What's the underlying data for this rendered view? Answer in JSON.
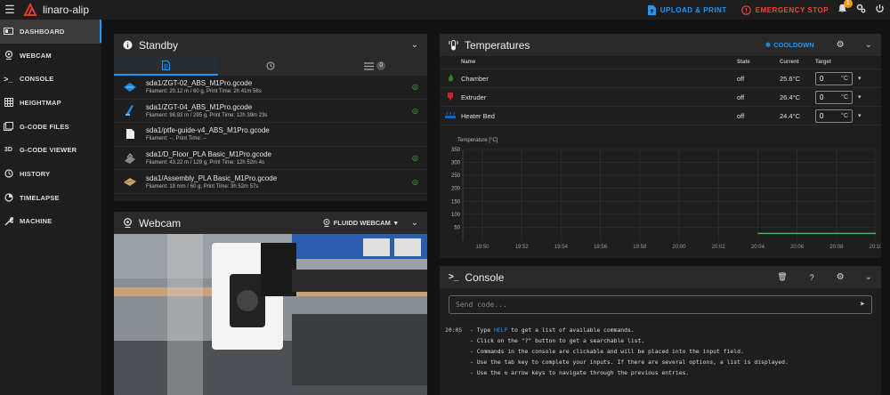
{
  "app": {
    "title": "linaro-alip"
  },
  "topbar": {
    "upload_label": "UPLOAD & PRINT",
    "estop_label": "EMERGENCY STOP",
    "notifications_count": "1"
  },
  "sidebar": {
    "items": [
      {
        "label": "DASHBOARD",
        "icon": "dashboard-icon"
      },
      {
        "label": "WEBCAM",
        "icon": "webcam-icon"
      },
      {
        "label": "CONSOLE",
        "icon": "console-icon"
      },
      {
        "label": "HEIGHTMAP",
        "icon": "grid-icon"
      },
      {
        "label": "G-CODE FILES",
        "icon": "files-icon"
      },
      {
        "label": "G-CODE VIEWER",
        "icon": "3d-icon"
      },
      {
        "label": "HISTORY",
        "icon": "history-icon"
      },
      {
        "label": "TIMELAPSE",
        "icon": "timelapse-icon"
      },
      {
        "label": "MACHINE",
        "icon": "wrench-icon"
      }
    ]
  },
  "standby": {
    "title": "Standby",
    "queue_count": "0",
    "files": [
      {
        "name": "sda1/ZGT-02_ABS_M1Pro.gcode",
        "meta": "Filament: 20.12 m / 60 g, Print Time: 2h 41m 56s"
      },
      {
        "name": "sda1/ZGT-04_ABS_M1Pro.gcode",
        "meta": "Filament: 98.93 m / 295 g, Print Time: 12h 39m 23s"
      },
      {
        "name": "sda1/ptfe-guide-v4_ABS_M1Pro.gcode",
        "meta": "Filament: --, Print Time: --"
      },
      {
        "name": "sda1/D_Floor_PLA Basic_M1Pro.gcode",
        "meta": "Filament: 43.22 m / 129 g, Print Time: 12h 52m 4s"
      },
      {
        "name": "sda1/Assembly_PLA Basic_M1Pro.gcode",
        "meta": "Filament: 19 mm / 60 g, Print Time: 3h 52m 57s"
      }
    ]
  },
  "webcam": {
    "title": "Webcam",
    "source": "FLUIDD WEBCAM"
  },
  "temperatures": {
    "title": "Temperatures",
    "cooldown": "COOLDOWN",
    "headers": {
      "name": "Name",
      "state": "State",
      "current": "Current",
      "target": "Target"
    },
    "rows": [
      {
        "name": "Chamber",
        "state": "off",
        "current": "25.6°C",
        "target": "0",
        "unit": "°C"
      },
      {
        "name": "Extruder",
        "state": "off",
        "current": "26.4°C",
        "target": "0",
        "unit": "°C"
      },
      {
        "name": "Heater Bed",
        "state": "off",
        "current": "24.4°C",
        "target": "0",
        "unit": "°C"
      }
    ]
  },
  "chart_data": {
    "type": "line",
    "ylabel": "Temperature [°C]",
    "ylim": [
      0,
      350
    ],
    "yticks": [
      50,
      100,
      150,
      200,
      250,
      300,
      350
    ],
    "xticks": [
      "19:50",
      "19:52",
      "19:54",
      "19:56",
      "19:58",
      "20:00",
      "20:02",
      "20:04",
      "20:06",
      "20:08",
      "20:10"
    ],
    "series": [
      {
        "color": "#4caf50",
        "points": [
          [
            "20:04",
            26
          ],
          [
            "20:10",
            26
          ]
        ]
      }
    ]
  },
  "console": {
    "title": "Console",
    "placeholder": "Send code...",
    "log": [
      {
        "time": "20:05",
        "pre": "- Type ",
        "link": "HELP",
        "post": " to get a list of available commands."
      },
      {
        "time": "",
        "pre": "- Click on the \"?\" button to get a searchable list.",
        "link": "",
        "post": ""
      },
      {
        "time": "",
        "pre": "- Commands in the console are clickable and will be placed into the input field.",
        "link": "",
        "post": ""
      },
      {
        "time": "",
        "pre": "- Use the tab key to complete your inputs. If there are several options, a list is displayed.",
        "link": "",
        "post": ""
      },
      {
        "time": "",
        "pre": "- Use the ⇅ arrow keys to navigate through the previous entries.",
        "link": "",
        "post": ""
      }
    ]
  }
}
